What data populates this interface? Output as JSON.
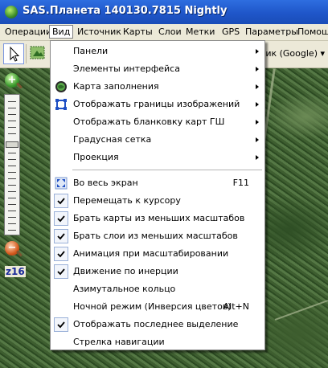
{
  "window": {
    "title": "SAS.Планета 140130.7815 Nightly"
  },
  "menubar": {
    "items": [
      "Операции",
      "Вид",
      "Источник",
      "Карты",
      "Слои",
      "Метки",
      "GPS",
      "Параметры",
      "Помощь"
    ],
    "active_index": 1
  },
  "toolbar": {
    "map_source": "ник (Google) ▾"
  },
  "zoom": {
    "level_label": "z16"
  },
  "view_menu": {
    "group1": [
      {
        "label": "Панели",
        "submenu": true,
        "icon": "none"
      },
      {
        "label": "Элементы интерфейса",
        "submenu": true,
        "icon": "none"
      },
      {
        "label": "Карта заполнения",
        "submenu": true,
        "icon": "globe-icon"
      },
      {
        "label": "Отображать границы изображений",
        "submenu": true,
        "icon": "bounds-icon"
      },
      {
        "label": "Отображать бланковку карт ГШ",
        "submenu": true,
        "icon": "none"
      },
      {
        "label": "Градусная сетка",
        "submenu": true,
        "icon": "none"
      },
      {
        "label": "Проекция",
        "submenu": true,
        "icon": "none"
      }
    ],
    "group2": [
      {
        "label": "Во весь экран",
        "shortcut": "F11",
        "checked": false,
        "icon": "fullscreen-icon"
      },
      {
        "label": "Перемещать к курсору",
        "shortcut": "",
        "checked": true
      },
      {
        "label": "Брать карты из меньших масштабов",
        "shortcut": "",
        "checked": true
      },
      {
        "label": "Брать слои из меньших масштабов",
        "shortcut": "",
        "checked": true
      },
      {
        "label": "Анимация при масштабировании",
        "shortcut": "",
        "checked": true
      },
      {
        "label": "Движение по инерции",
        "shortcut": "",
        "checked": true
      },
      {
        "label": "Азимутальное кольцо",
        "shortcut": "",
        "checked": false
      },
      {
        "label": "Ночной режим (Инверсия цветов)",
        "shortcut": "Alt+N",
        "checked": false
      },
      {
        "label": "Отображать последнее выделение",
        "shortcut": "",
        "checked": true
      },
      {
        "label": "Стрелка навигации",
        "shortcut": "",
        "checked": false
      }
    ]
  },
  "colors": {
    "titlebar": "#1f56c9",
    "menu_bg": "#ece9d8",
    "check_border": "#9ab0d8"
  }
}
